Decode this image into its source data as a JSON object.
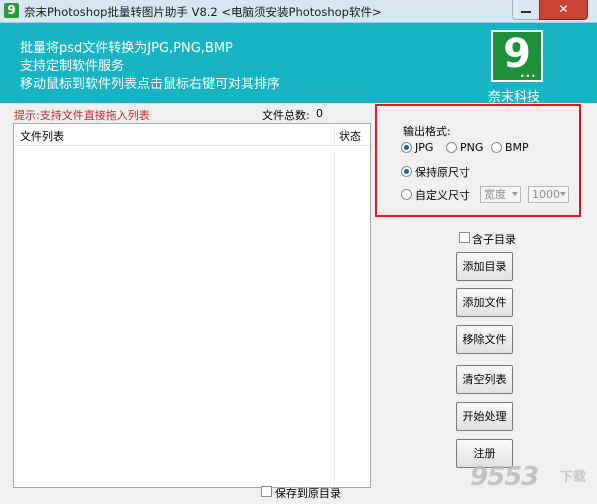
{
  "window": {
    "title": "奈末Photoshop批量转图片助手 V8.2 <电脑须安装Photoshop软件>",
    "close_label": "✕",
    "app_icon": "9"
  },
  "banner": {
    "lines": [
      "批量将psd文件转换为JPG,PNG,BMP",
      "支持定制软件服务",
      "移动鼠标到软件列表点击鼠标右键可对其排序"
    ],
    "company": "奈末科技",
    "logo_text": "9"
  },
  "list_panel": {
    "hint": "提示:支持文件直接拖入列表",
    "count_label": "文件总数:",
    "count_value": "0",
    "columns": [
      "文件列表",
      "状态"
    ]
  },
  "save_to_original": {
    "label": "保存到原目录",
    "checked": false
  },
  "output": {
    "title": "输出格式:",
    "formats": [
      {
        "label": "JPG",
        "selected": true
      },
      {
        "label": "PNG",
        "selected": false
      },
      {
        "label": "BMP",
        "selected": false
      }
    ],
    "size_options": [
      {
        "label": "保持原尺寸",
        "selected": true
      },
      {
        "label": "自定义尺寸",
        "selected": false
      }
    ],
    "dimension_select": "宽度",
    "size_select": "1000"
  },
  "include_subdir": {
    "label": "含子目录",
    "checked": false
  },
  "buttons": [
    "添加目录",
    "添加文件",
    "移除文件",
    "清空列表",
    "开始处理",
    "注册"
  ],
  "watermark": {
    "text": "9553",
    "suffix": "下载"
  },
  "colors": {
    "banner": "#19b4c4",
    "logo": "#1e8f3a",
    "highlight": "#e0151f",
    "hint": "#c0282d"
  }
}
